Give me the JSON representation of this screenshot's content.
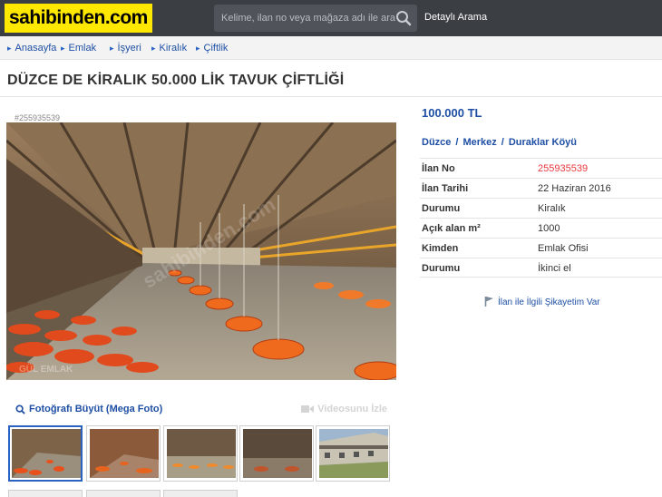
{
  "header": {
    "logo": "sahibinden.com",
    "search_placeholder": "Kelime, ilan no veya mağaza adı ile ara",
    "advanced_search": "Detaylı Arama"
  },
  "breadcrumb": [
    "Anasayfa",
    "Emlak",
    "İşyeri",
    "Kiralık",
    "Çiftlik"
  ],
  "listing": {
    "title": "DÜZCE DE KİRALIK 50.000 LİK TAVUK ÇİFTLİĞİ",
    "ad_number_tag": "#255935539",
    "photo_watermark": "sahibinden.com",
    "photo_corner_mark": "GÜL EMLAK",
    "mega_photo": "Fotoğrafı Büyüt (Mega Foto)",
    "video": "Videosunu İzle",
    "price": "100.000 TL",
    "location": {
      "city": "Düzce",
      "district": "Merkez",
      "neighborhood": "Duraklar Köyü",
      "sep": "/"
    },
    "details": [
      {
        "key": "İlan No",
        "value": "255935539"
      },
      {
        "key": "İlan Tarihi",
        "value": "22 Haziran 2016"
      },
      {
        "key": "Durumu",
        "value": "Kiralık"
      },
      {
        "key": "Açık alan m²",
        "value": "1000"
      },
      {
        "key": "Kimden",
        "value": "Emlak Ofisi"
      },
      {
        "key": "Durumu",
        "value": "İkinci el"
      }
    ],
    "complaint": "İlan ile İlgili Şikayetim Var"
  },
  "colors": {
    "header_bg": "#3b3e43",
    "logo_bg": "#ffe800",
    "link": "#1e4fa4",
    "accent_red": "#e8373c"
  }
}
